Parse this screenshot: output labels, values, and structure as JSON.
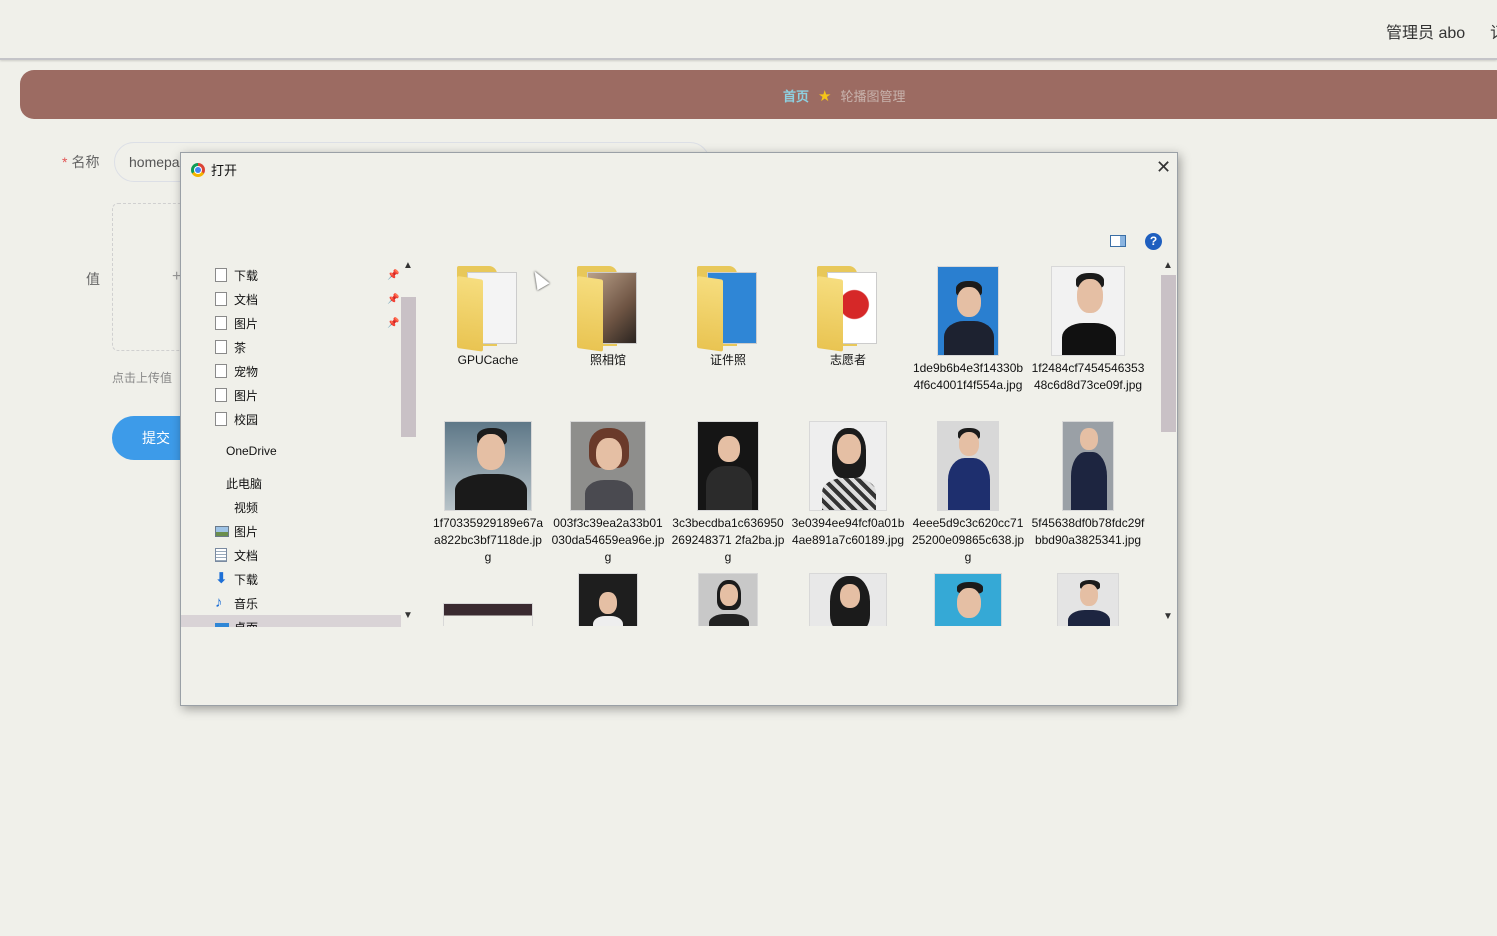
{
  "header": {
    "user_label": "管理员 abo",
    "edge_char": "订"
  },
  "breadcrumb": {
    "home": "首页",
    "current": "轮播图管理"
  },
  "form": {
    "name_label": "名称",
    "name_value": "homepa",
    "value_label": "值",
    "upload_hint": "点击上传值",
    "submit_label": "提交"
  },
  "dialog": {
    "title": "打开",
    "close": "✕",
    "help": "?",
    "nav": [
      {
        "label": "下载",
        "icon": "file-icon",
        "pinned": true
      },
      {
        "label": "文档",
        "icon": "file-icon",
        "pinned": true
      },
      {
        "label": "图片",
        "icon": "file-icon",
        "pinned": true
      },
      {
        "label": "茶",
        "icon": "file-icon"
      },
      {
        "label": "宠物",
        "icon": "file-icon"
      },
      {
        "label": "图片",
        "icon": "file-icon"
      },
      {
        "label": "校园",
        "icon": "file-icon"
      },
      {
        "label": "OneDrive",
        "icon": "none"
      },
      {
        "label": "此电脑",
        "icon": "none"
      },
      {
        "label": "视频",
        "icon": "none"
      },
      {
        "label": "图片",
        "icon": "pictures-icon"
      },
      {
        "label": "文档",
        "icon": "documents-icon"
      },
      {
        "label": "下载",
        "icon": "download-icon"
      },
      {
        "label": "音乐",
        "icon": "music-icon"
      },
      {
        "label": "桌面",
        "icon": "desktop-icon",
        "selected": true
      }
    ],
    "files": [
      {
        "name": "GPUCache",
        "kind": "folder"
      },
      {
        "name": "照相馆",
        "kind": "folder"
      },
      {
        "name": "证件照",
        "kind": "folder"
      },
      {
        "name": "志愿者",
        "kind": "folder"
      },
      {
        "name": "1de9b6b4e3f14330b4f6c4001f4f554a.jpg",
        "kind": "image"
      },
      {
        "name": "1f2484cf745454635348c6d8d73ce09f.jpg",
        "kind": "image"
      },
      {
        "name": "1f70335929189e67aa822bc3bf7118de.jpg",
        "kind": "image"
      },
      {
        "name": "003f3c39ea2a33b01030da54659ea96e.jpg",
        "kind": "image"
      },
      {
        "name": "3c3becdba1c636950269248371 2fa2ba.jpg",
        "kind": "image"
      },
      {
        "name": "3e0394ee94fcf0a01b4ae891a7c60189.jpg",
        "kind": "image"
      },
      {
        "name": "4eee5d9c3c620cc7125200e09865c638.jpg",
        "kind": "image"
      },
      {
        "name": "5f45638df0b78fdc29fbbd90a3825341.jpg",
        "kind": "image"
      }
    ]
  },
  "colors": {
    "breadcrumb_bg": "#9c6b62",
    "home_link": "#8ed0e0",
    "submit_bg": "#3d9be9",
    "required": "#e25555"
  }
}
